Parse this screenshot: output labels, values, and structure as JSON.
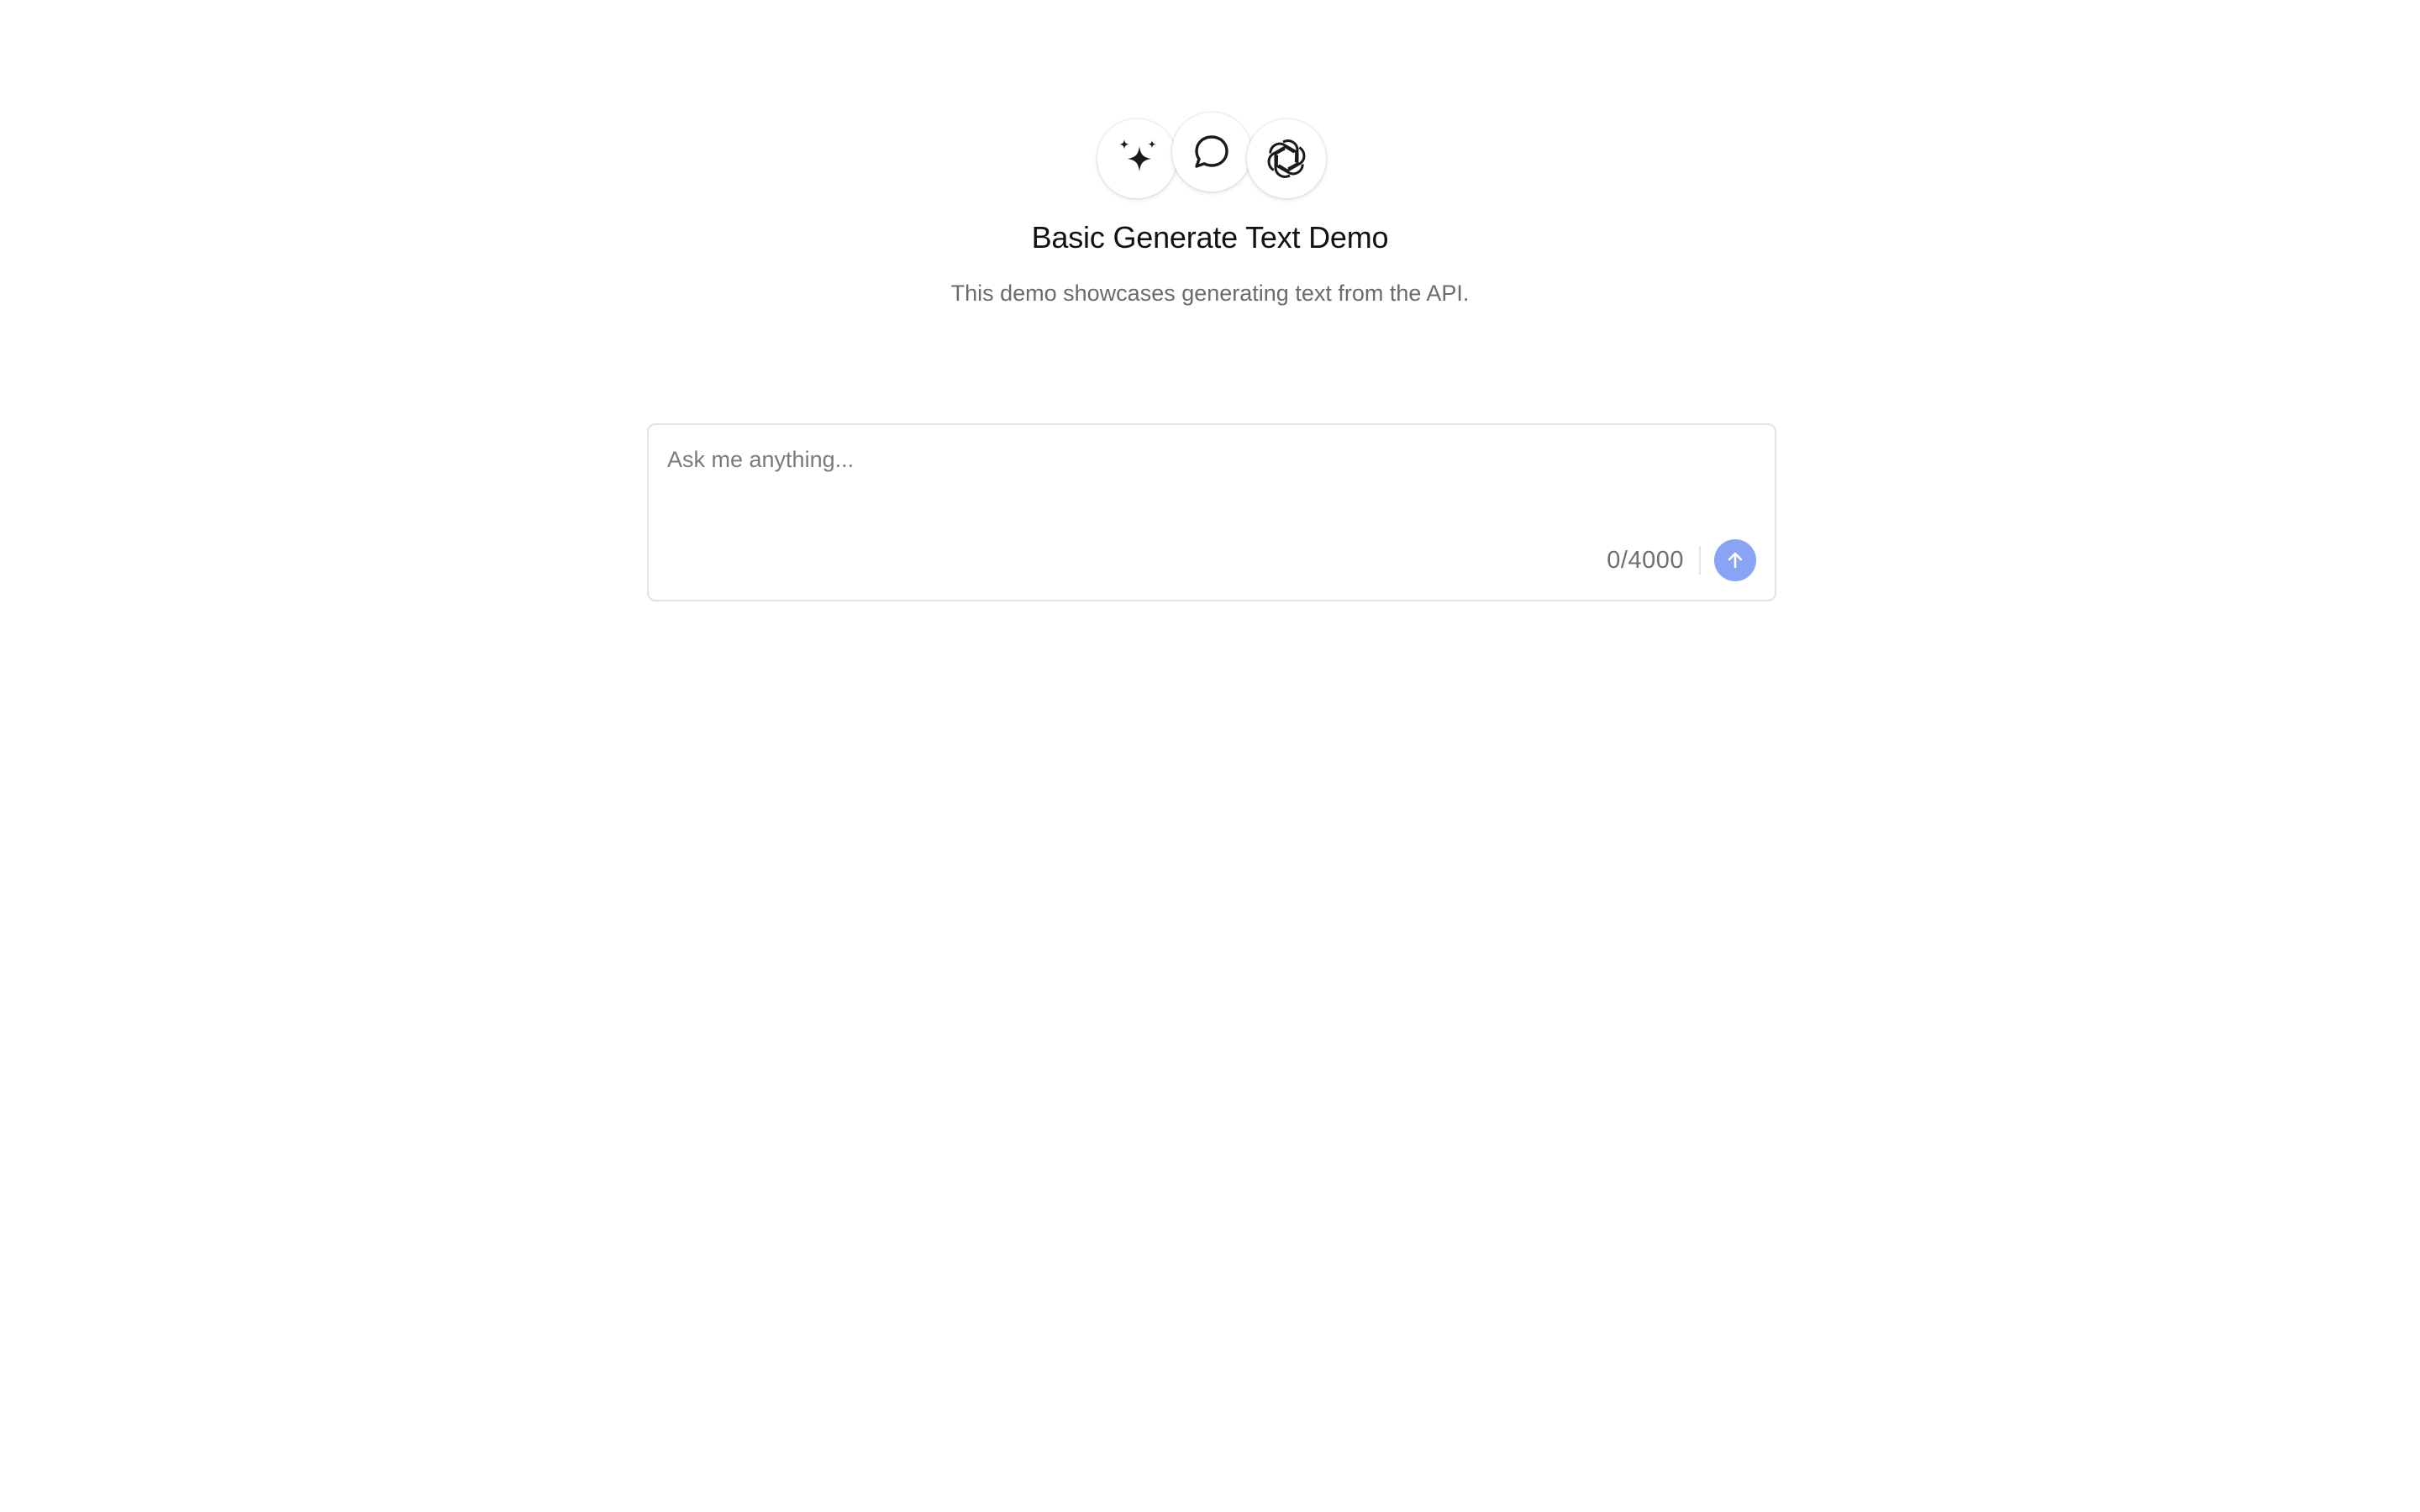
{
  "header": {
    "icons": [
      "sparkles-icon",
      "chat-bubble-icon",
      "openai-logo-icon"
    ],
    "title": "Basic Generate Text Demo",
    "subtitle": "This demo showcases generating text from the API."
  },
  "composer": {
    "placeholder": "Ask me anything...",
    "value": "",
    "char_count": "0/4000",
    "send_icon": "arrow-up-icon"
  },
  "colors": {
    "send_button": "#8aa4f5",
    "title": "#111111",
    "subtitle": "#6b6b6b",
    "border": "#e2e2e2"
  }
}
